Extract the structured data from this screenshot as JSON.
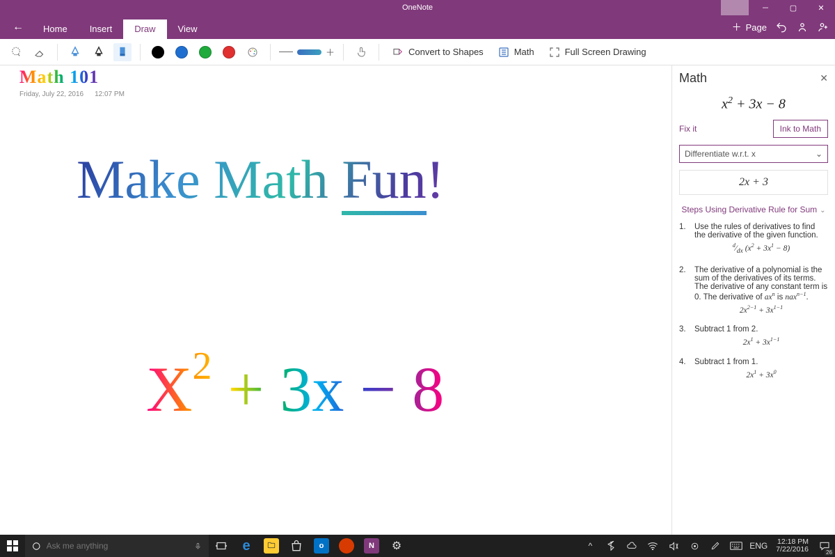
{
  "titlebar": {
    "app_name": "OneNote"
  },
  "tabs": {
    "items": [
      "Home",
      "Insert",
      "Draw",
      "View"
    ],
    "active_index": 2
  },
  "ribbon_right": {
    "add_page": "Page"
  },
  "toolbar": {
    "swatch_colors": [
      "#000000",
      "#1f6fd0",
      "#1faa3c",
      "#e03030"
    ],
    "convert_to_shapes": "Convert to Shapes",
    "math": "Math",
    "fullscreen": "Full Screen Drawing"
  },
  "page": {
    "title_ink": "Math  101",
    "date": "Friday, July 22, 2016",
    "time": "12:07 PM",
    "headline_1": "Make  Math ",
    "headline_fun": "Fun",
    "headline_bang": "!",
    "equation_ink_base_x": "X",
    "equation_ink_exp": "2",
    "equation_ink_rest": " + 3x − 8"
  },
  "math_panel": {
    "title": "Math",
    "expression": "x² + 3x − 8",
    "fix_it": "Fix it",
    "ink_to_math": "Ink to Math",
    "action_selected": "Differentiate w.r.t. x",
    "result": "2x + 3",
    "steps_header": "Steps Using Derivative Rule for Sum",
    "steps": [
      {
        "n": "1.",
        "text": "Use the rules of derivatives to find the derivative of the given function.",
        "math": "d/dx (x² + 3x¹ − 8)"
      },
      {
        "n": "2.",
        "text": "The derivative of a polynomial is the sum of the derivatives of its terms. The derivative of any constant term is 0. The derivative of axⁿ is naxⁿ⁻¹.",
        "math": "2x²⁻¹ + 3x¹⁻¹"
      },
      {
        "n": "3.",
        "text": "Subtract 1 from 2.",
        "math": "2x¹ + 3x¹⁻¹"
      },
      {
        "n": "4.",
        "text": "Subtract 1 from 1.",
        "math": "2x¹ + 3x⁰"
      }
    ]
  },
  "taskbar": {
    "search_placeholder": "Ask me anything",
    "lang": "ENG",
    "time": "12:18 PM",
    "date": "7/22/2016",
    "notification_count": "26"
  }
}
